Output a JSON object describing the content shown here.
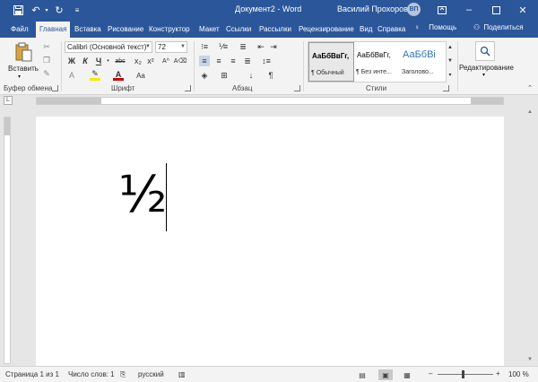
{
  "titlebar": {
    "document_title": "Документ2  -  Word",
    "user_name": "Василий Прохоров",
    "user_initials": "ВП",
    "accent_color": "#2b579a"
  },
  "tabs": [
    "Файл",
    "Главная",
    "Вставка",
    "Рисование",
    "Конструктор",
    "Макет",
    "Ссылки",
    "Рассылки",
    "Рецензирование",
    "Вид",
    "Справка"
  ],
  "active_tab": "Главная",
  "help_label": "Помощь",
  "share_label": "Поделиться",
  "ribbon": {
    "paste_label": "Вставить",
    "clipboard_group": "Буфер обмена",
    "font_group": "Шрифт",
    "paragraph_group": "Абзац",
    "styles_group": "Стили",
    "font_name": "Calibri (Основной текст)",
    "font_size": "72",
    "bold": "Ж",
    "italic": "К",
    "underline": "Ч",
    "strike": "abc",
    "subscript": "x₂",
    "superscript": "x²",
    "font_color_letter": "A",
    "grow_font": "Aa",
    "styles": [
      {
        "preview": "АаБбВвГг,",
        "name": "¶ Обычный"
      },
      {
        "preview": "АаБбВвГг,",
        "name": "¶ Без инте..."
      },
      {
        "preview": "АаБбВі",
        "name": "Заголово..."
      }
    ],
    "editing_label": "Редактирование"
  },
  "document": {
    "content": "½"
  },
  "statusbar": {
    "page_info": "Страница 1 из 1",
    "word_count": "Число слов: 1",
    "language": "русский",
    "zoom": "100 %"
  }
}
